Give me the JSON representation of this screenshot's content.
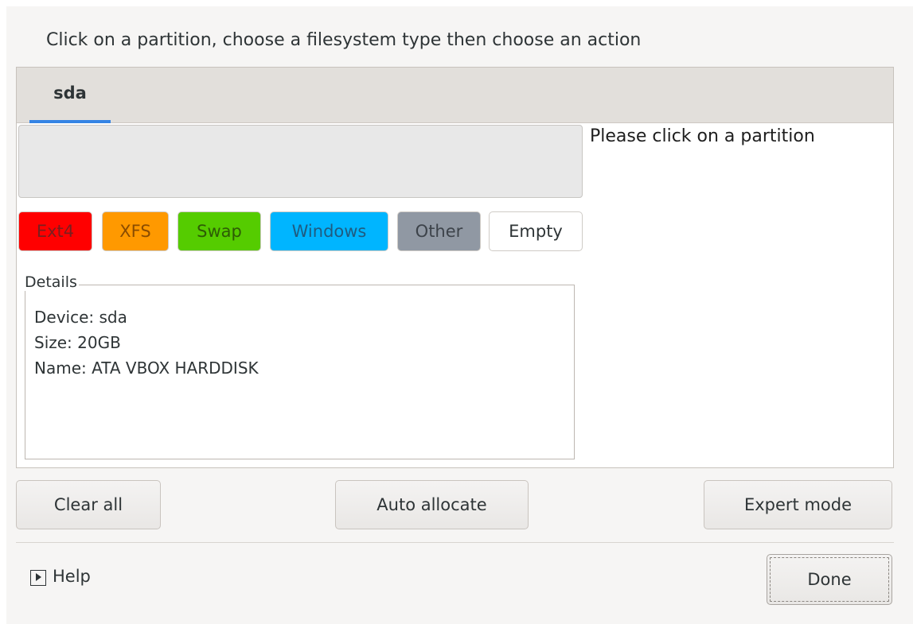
{
  "instruction": "Click on a partition, choose a filesystem type then choose an action",
  "tabs": [
    {
      "label": "sda",
      "active": true
    }
  ],
  "side_message": "Please click on a partition",
  "filesystem_types": [
    {
      "label": "Ext4",
      "color": "#ff0000"
    },
    {
      "label": "XFS",
      "color": "#ff9900"
    },
    {
      "label": "Swap",
      "color": "#55cc00"
    },
    {
      "label": "Windows",
      "color": "#00b5ff"
    },
    {
      "label": "Other",
      "color": "#9098a3"
    },
    {
      "label": "Empty",
      "color": "#ffffff"
    }
  ],
  "details": {
    "legend": "Details",
    "lines": [
      "Device: sda",
      "Size: 20GB",
      "Name: ATA VBOX HARDDISK"
    ]
  },
  "actions": {
    "clear_all": "Clear all",
    "auto_allocate": "Auto allocate",
    "expert_mode": "Expert mode"
  },
  "footer": {
    "help_label": "Help",
    "help_icon": "expander-arrow-icon",
    "done_label": "Done"
  },
  "colors": {
    "accent": "#3584e4",
    "window_bg": "#f6f5f4",
    "tabbar_bg": "#e2dfdb"
  }
}
